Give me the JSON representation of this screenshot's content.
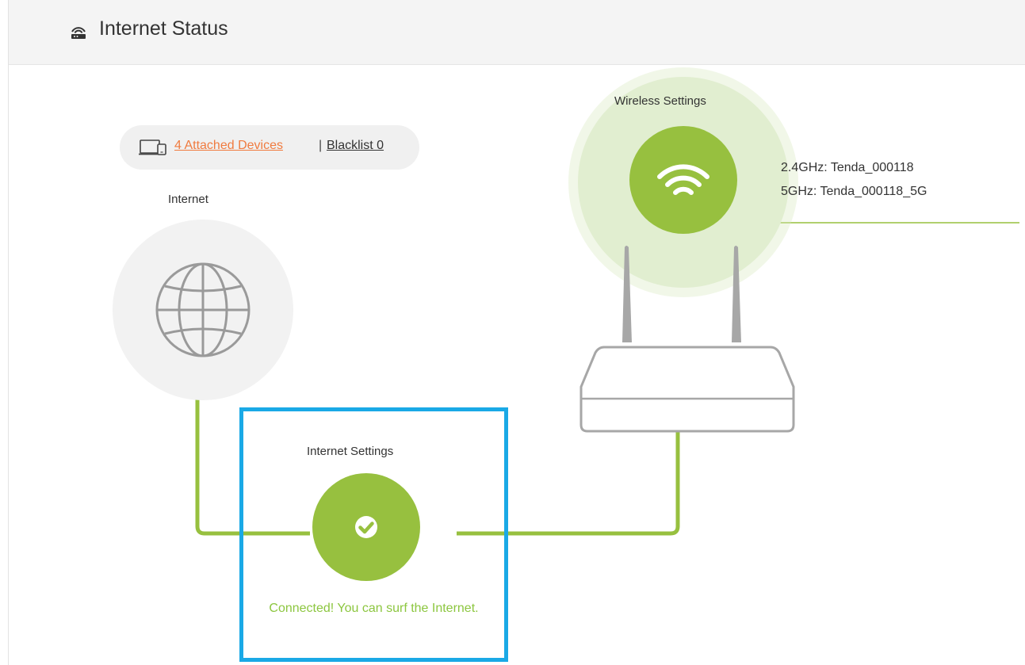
{
  "header": {
    "title": "Internet Status",
    "icon": "router-icon"
  },
  "devices": {
    "attached_label": "4 Attached Devices ",
    "separator": "|",
    "blacklist_label": "Blacklist 0",
    "link_color": "#f07b3f"
  },
  "internet": {
    "label": "Internet",
    "icon": "globe-icon"
  },
  "wireless": {
    "label": "Wireless Settings",
    "icon": "wifi-icon",
    "ssid_24": "2.4GHz: Tenda_000118",
    "ssid_5": "5GHz: Tenda_000118_5G"
  },
  "internet_settings": {
    "label": "Internet Settings",
    "icon": "check-icon",
    "status": "Connected! You can surf the Internet."
  },
  "colors": {
    "accent_green": "#97c03f",
    "status_green": "#8cc63f",
    "highlight_blue": "#1aa9e6"
  }
}
